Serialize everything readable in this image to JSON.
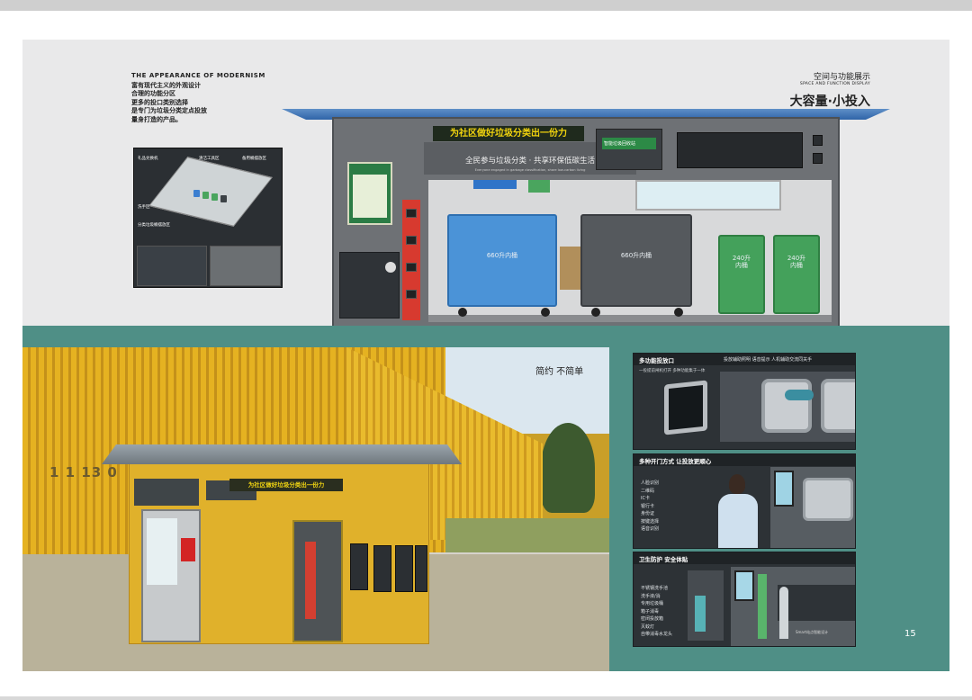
{
  "intro": {
    "en": "THE APPEARANCE OF MODERNISM",
    "lines": [
      "富有现代主义的外观设计",
      "合理的功能分区",
      "更多的投口类别选择",
      "是专门为垃圾分类定点投放",
      "量身打造的产品。"
    ]
  },
  "plan_labels": {
    "l1": "礼品兑换机",
    "l2": "清洁工具区",
    "l3": "备用桶摆放区",
    "l4": "洗手区",
    "l5": "分类垃圾桶摆放区"
  },
  "section": {
    "cn": "空间与功能展示",
    "en": "SPACE AND FUNCTION DISPLAY",
    "big": "大容量·小投入"
  },
  "station": {
    "slogan_yellow": "为社区做好垃圾分类出一份力",
    "slogan_grey": "全民参与垃圾分类 · 共享环保低碳生活",
    "slogan_grey_en": "Everyone engaged in garbage classification, share low-carbon living",
    "logo_text": "智能垃圾回收站",
    "bin_blue": "660升内桶",
    "bin_grey": "660升内桶",
    "bin_green1": [
      "240升",
      "内桶"
    ],
    "bin_green2": [
      "240升",
      "内桶"
    ]
  },
  "photo": {
    "caption": "简约 不简单",
    "building_number": "1 1 13 0",
    "kiosk_slogan": "为社区做好垃圾分类出一份力"
  },
  "panels": {
    "p1": {
      "title": "多功能投放口",
      "desc": "投放辅助照明 语音提示 人机辅助交流同关手",
      "note": "一投提前闸机打开 多种功能集于一体"
    },
    "p2": {
      "title": "多种开门方式 让投放更顺心",
      "items": [
        "人脸识别",
        "二维码",
        "IC卡",
        "银行卡",
        "身份证",
        "按键选择",
        "语音识别"
      ]
    },
    "p3": {
      "title": "卫生防护 安全体贴",
      "items": [
        "不锈钢洗手池",
        "洗手液/消",
        "专用垃圾桶",
        "箱子消毒",
        "密闭投放箱",
        "灭蚊灯",
        "自带消毒水龙头"
      ],
      "foot": "Smart站点智能设计"
    }
  },
  "page_number": "15"
}
